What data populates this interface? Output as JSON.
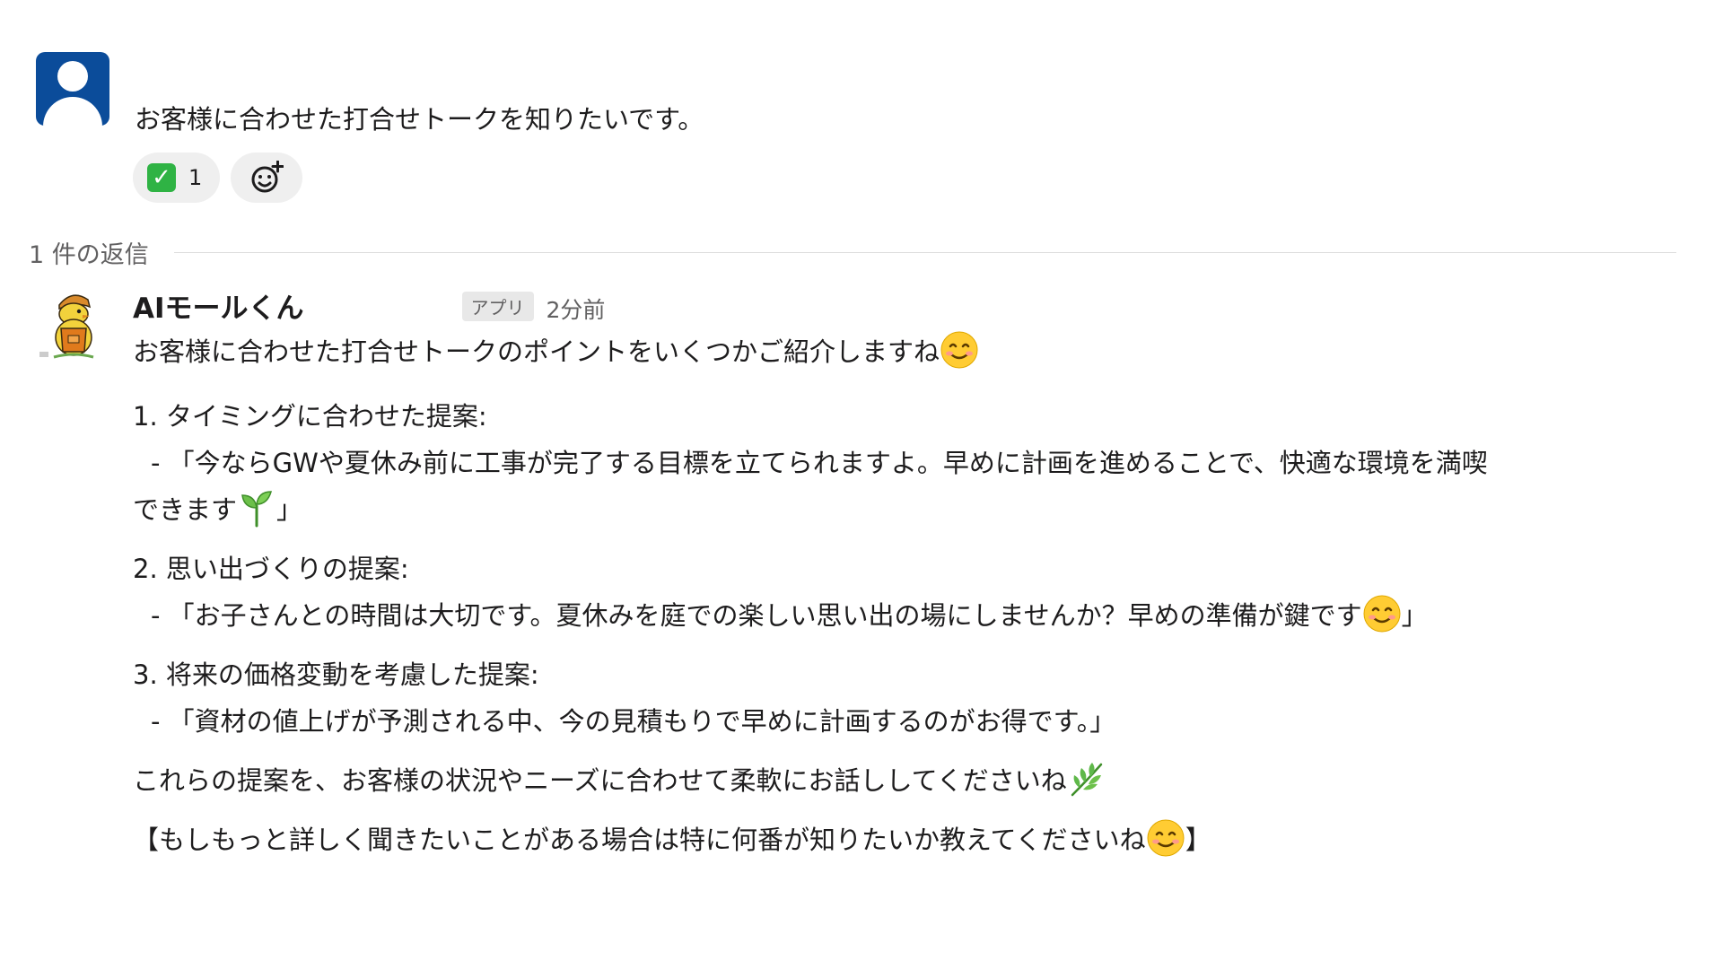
{
  "parent": {
    "text": "お客様に合わせた打合せトークを知りたいです。",
    "reaction": {
      "emoji": "white-check-mark",
      "count": "1"
    },
    "add_reaction_icon": "add-emoji-icon"
  },
  "replies": {
    "count_label": "1 件の返信"
  },
  "reply": {
    "author": "AIモールくん",
    "badge": "アプリ",
    "time": "2分前",
    "intro": "お客様に合わせた打合せトークのポイントをいくつかご紹介しますね",
    "items": [
      {
        "title": "1. タイミングに合わせた提案:",
        "line1": "- 「今ならGWや夏休み前に工事が完了する目標を立てられますよ。早めに計画を進めることで、快適な環境を満喫",
        "line2": "できます",
        "line2_end": "」"
      },
      {
        "title": "2. 思い出づくりの提案:",
        "line1": "- 「お子さんとの時間は大切です。夏休みを庭での楽しい思い出の場にしませんか？早めの準備が鍵です",
        "line1_end": "」"
      },
      {
        "title": "3. 将来の価格変動を考慮した提案:",
        "line1": "- 「資材の値上げが予測される中、今の見積もりで早めに計画するのがお得です。」"
      }
    ],
    "closing": "これらの提案を、お客様の状況やニーズに合わせて柔軟にお話ししてくださいね",
    "followup_start": "【もしもっと詳しく聞きたいことがある場合は特に何番が知りたいか教えてくださいね",
    "followup_end": "】"
  },
  "colors": {
    "user_avatar": "#0b4c9a",
    "reaction_bg": "#efefef",
    "check_green": "#2fb344",
    "muted_text": "#616061"
  }
}
